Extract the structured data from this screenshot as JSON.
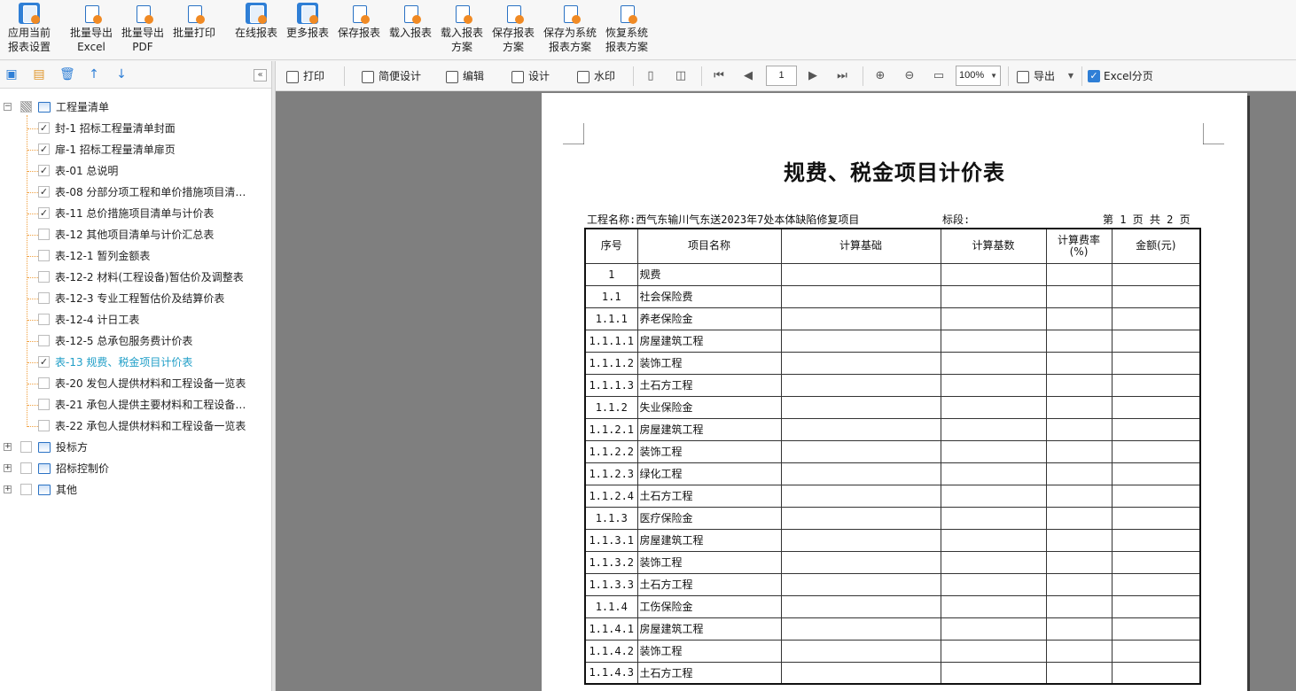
{
  "ribbon": {
    "buttons": [
      {
        "line1": "应用当前",
        "line2": "报表设置"
      },
      {
        "line1": "批量导出",
        "line2": "Excel"
      },
      {
        "line1": "批量导出",
        "line2": "PDF"
      },
      {
        "line1": "批量打印",
        "line2": ""
      },
      {
        "line1": "在线报表",
        "line2": ""
      },
      {
        "line1": "更多报表",
        "line2": ""
      },
      {
        "line1": "保存报表",
        "line2": ""
      },
      {
        "line1": "载入报表",
        "line2": ""
      },
      {
        "line1": "载入报表",
        "line2": "方案"
      },
      {
        "line1": "保存报表",
        "line2": "方案"
      },
      {
        "line1": "保存为系统",
        "line2": "报表方案"
      },
      {
        "line1": "恢复系统",
        "line2": "报表方案"
      }
    ]
  },
  "tree_toolbar": {
    "collapse_glyph": "«"
  },
  "tree": {
    "root": {
      "label": "工程量清单"
    },
    "children": [
      {
        "label": "封-1 招标工程量清单封面",
        "checked": true
      },
      {
        "label": "扉-1 招标工程量清单扉页",
        "checked": true
      },
      {
        "label": "表-01 总说明",
        "checked": true
      },
      {
        "label": "表-08 分部分项工程和单价措施项目清…",
        "checked": true
      },
      {
        "label": "表-11 总价措施项目清单与计价表",
        "checked": true
      },
      {
        "label": "表-12 其他项目清单与计价汇总表",
        "checked": false
      },
      {
        "label": "表-12-1 暂列金额表",
        "checked": false
      },
      {
        "label": "表-12-2 材料(工程设备)暂估价及调整表",
        "checked": false
      },
      {
        "label": "表-12-3 专业工程暂估价及结算价表",
        "checked": false
      },
      {
        "label": "表-12-4 计日工表",
        "checked": false
      },
      {
        "label": "表-12-5 总承包服务费计价表",
        "checked": false
      },
      {
        "label": "表-13 规费、税金项目计价表",
        "checked": true
      },
      {
        "label": "表-20 发包人提供材料和工程设备一览表",
        "checked": false
      },
      {
        "label": "表-21 承包人提供主要材料和工程设备…",
        "checked": false
      },
      {
        "label": "表-22 承包人提供材料和工程设备一览表",
        "checked": false
      }
    ],
    "others": [
      {
        "label": "投标方"
      },
      {
        "label": "招标控制价"
      },
      {
        "label": "其他"
      }
    ]
  },
  "preview_toolbar": {
    "print": "打印",
    "simple_design": "简便设计",
    "edit": "编辑",
    "design": "设计",
    "watermark": "水印",
    "page": "1",
    "zoom": "100%",
    "export": "导出",
    "excel_paging": "Excel分页"
  },
  "document": {
    "title": "规费、税金项目计价表",
    "project_label": "工程名称:西气东输川气东送2023年7处本体缺陷修复项目",
    "section_label": "标段:",
    "page_info": "第 1 页  共 2 页",
    "columns": [
      "序号",
      "项目名称",
      "计算基础",
      "计算基数",
      "计算费率\n(%)",
      "金额(元)"
    ],
    "rows": [
      {
        "no": "1",
        "name": "规费"
      },
      {
        "no": "1.1",
        "name": "社会保险费"
      },
      {
        "no": "1.1.1",
        "name": "养老保险金"
      },
      {
        "no": "1.1.1.1",
        "name": "房屋建筑工程"
      },
      {
        "no": "1.1.1.2",
        "name": "装饰工程"
      },
      {
        "no": "1.1.1.3",
        "name": "土石方工程"
      },
      {
        "no": "1.1.2",
        "name": "失业保险金"
      },
      {
        "no": "1.1.2.1",
        "name": "房屋建筑工程"
      },
      {
        "no": "1.1.2.2",
        "name": "装饰工程"
      },
      {
        "no": "1.1.2.3",
        "name": "绿化工程"
      },
      {
        "no": "1.1.2.4",
        "name": "土石方工程"
      },
      {
        "no": "1.1.3",
        "name": "医疗保险金"
      },
      {
        "no": "1.1.3.1",
        "name": "房屋建筑工程"
      },
      {
        "no": "1.1.3.2",
        "name": "装饰工程"
      },
      {
        "no": "1.1.3.3",
        "name": "土石方工程"
      },
      {
        "no": "1.1.4",
        "name": "工伤保险金"
      },
      {
        "no": "1.1.4.1",
        "name": "房屋建筑工程"
      },
      {
        "no": "1.1.4.2",
        "name": "装饰工程"
      },
      {
        "no": "1.1.4.3",
        "name": "土石方工程"
      }
    ]
  }
}
